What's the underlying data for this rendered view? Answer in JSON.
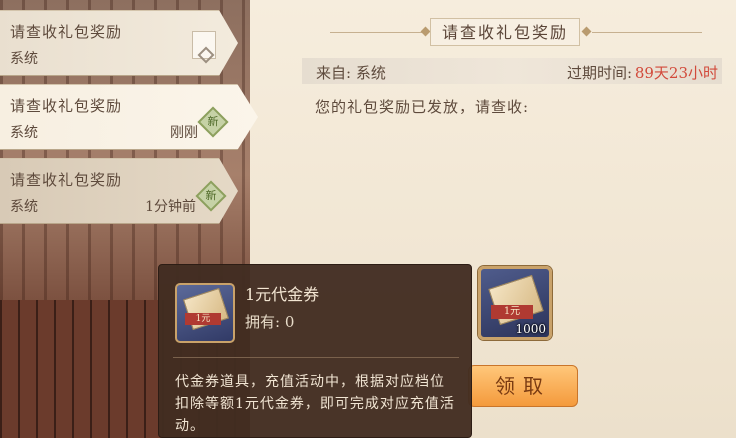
{
  "mail_list": [
    {
      "title": "请查收礼包奖励",
      "sender": "系统",
      "time": ""
    },
    {
      "title": "请查收礼包奖励",
      "sender": "系统",
      "time": "刚刚",
      "badge": "新"
    },
    {
      "title": "请查收礼包奖励",
      "sender": "系统",
      "time": "1分钟前",
      "badge": "新"
    }
  ],
  "detail": {
    "title": "请查收礼包奖励",
    "from_label": "来自: 系统",
    "expire_label": "过期时间:",
    "expire_value": "89天23小时",
    "body": "您的礼包奖励已发放，请查收:",
    "reward_count": "1000",
    "reward_tag": "1元",
    "claim_label": "领取"
  },
  "tooltip": {
    "name": "1元代金券",
    "owned_label": "拥有: 0",
    "tag": "1元",
    "description": "代金券道具，充值活动中，根据对应档位扣除等额1元代金券，即可完成对应充值活动。"
  },
  "colors": {
    "expire": "#d24a3b",
    "claim_button": "#f49a3c",
    "new_badge": "#8da05e"
  }
}
